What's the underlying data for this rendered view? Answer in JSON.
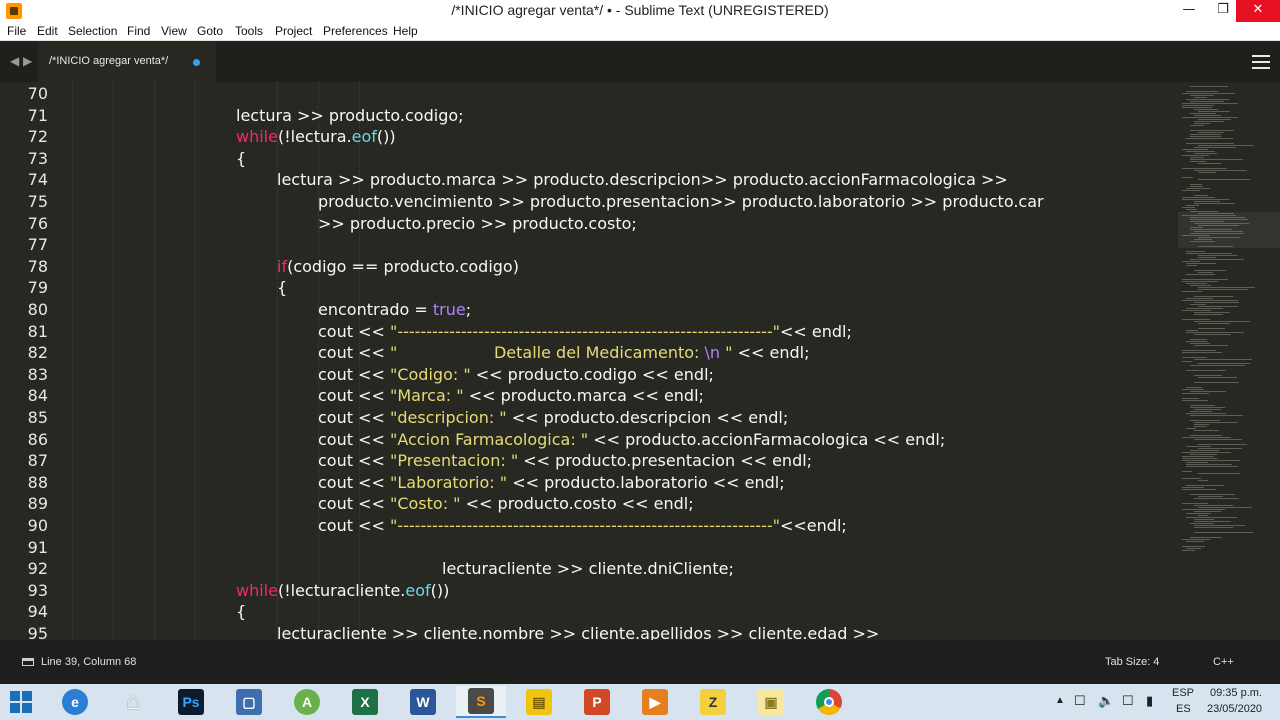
{
  "window": {
    "title": "/*INICIO agregar venta*/ • - Sublime Text (UNREGISTERED)"
  },
  "menu": [
    "File",
    "Edit",
    "Selection",
    "Find",
    "View",
    "Goto",
    "Tools",
    "Project",
    "Preferences",
    "Help"
  ],
  "tab": {
    "label": "/*INICIO agregar venta*/"
  },
  "editor": {
    "line_numbers": [
      "70",
      "71",
      "72",
      "73",
      "74",
      "75",
      "76",
      "77",
      "78",
      "79",
      "80",
      "81",
      "82",
      "83",
      "84",
      "85",
      "86",
      "87",
      "88",
      "89",
      "90",
      "91",
      "92",
      "93",
      "94",
      "95"
    ],
    "lines": [
      [],
      [
        {
          "t": "lectura >> producto.codigo;"
        }
      ],
      [
        {
          "t": "while",
          "c": "kw"
        },
        {
          "t": "(!lectura."
        },
        {
          "t": "eof",
          "c": "fn"
        },
        {
          "t": "())"
        }
      ],
      [
        {
          "t": "{"
        }
      ],
      [
        {
          "t": "lectura >> producto.marca >> producto.descripcion>> producto.accionFarmacologica >>"
        }
      ],
      [
        {
          "t": "producto.vencimiento >> producto.presentacion>> producto.laboratorio >> producto.car"
        }
      ],
      [
        {
          "t": ">> producto.precio >> producto.costo;"
        }
      ],
      [],
      [
        {
          "t": "if",
          "c": "kw"
        },
        {
          "t": "(codigo == producto.codigo)"
        }
      ],
      [
        {
          "t": "{"
        }
      ],
      [
        {
          "t": "encontrado = "
        },
        {
          "t": "true",
          "c": "bool"
        },
        {
          "t": ";"
        }
      ],
      [
        {
          "t": "cout << "
        },
        {
          "t": "\"-----------------------------------------------------------------\"",
          "c": "str"
        },
        {
          "t": "<< endl;"
        }
      ],
      [
        {
          "t": "cout << "
        },
        {
          "t": "\"                   Detalle del Medicamento: ",
          "c": "str"
        },
        {
          "t": "\\n",
          "c": "esc"
        },
        {
          "t": " \"",
          "c": "str"
        },
        {
          "t": " << endl;"
        }
      ],
      [
        {
          "t": "cout << "
        },
        {
          "t": "\"Codigo: \"",
          "c": "str"
        },
        {
          "t": " << producto.codigo << endl;"
        }
      ],
      [
        {
          "t": "cout << "
        },
        {
          "t": "\"Marca: \"",
          "c": "str"
        },
        {
          "t": " << producto.marca << endl;"
        }
      ],
      [
        {
          "t": "cout << "
        },
        {
          "t": "\"descripcion: \"",
          "c": "str"
        },
        {
          "t": " << producto.descripcion << endl;"
        }
      ],
      [
        {
          "t": "cout << "
        },
        {
          "t": "\"Accion Farmacologica: \"",
          "c": "str"
        },
        {
          "t": " << producto.accionFarmacologica << endl;"
        }
      ],
      [
        {
          "t": "cout << "
        },
        {
          "t": "\"Presentacion: \"",
          "c": "str"
        },
        {
          "t": " << producto.presentacion << endl;"
        }
      ],
      [
        {
          "t": "cout << "
        },
        {
          "t": "\"Laboratorio: \"",
          "c": "str"
        },
        {
          "t": " << producto.laboratorio << endl;"
        }
      ],
      [
        {
          "t": "cout << "
        },
        {
          "t": "\"Costo: \"",
          "c": "str"
        },
        {
          "t": " << producto.costo << endl;"
        }
      ],
      [
        {
          "t": "cout << "
        },
        {
          "t": "\"-----------------------------------------------------------------\"",
          "c": "str"
        },
        {
          "t": "<<endl;"
        }
      ],
      [],
      [
        {
          "t": "lecturacliente >> cliente.dniCliente;"
        }
      ],
      [
        {
          "t": "while",
          "c": "kw"
        },
        {
          "t": "(!lecturacliente."
        },
        {
          "t": "eof",
          "c": "fn"
        },
        {
          "t": "())"
        }
      ],
      [
        {
          "t": "{"
        }
      ],
      [
        {
          "t": "lecturacliente >> cliente.nombre >> cliente.apellidos >> cliente.edad >>"
        }
      ]
    ]
  },
  "status": {
    "position": "Line 39, Column 68",
    "tab_size": "Tab Size: 4",
    "syntax": "C++"
  },
  "taskbar": {
    "apps": [
      "ie-icon",
      "home-icon",
      "photoshop-icon",
      "virtualbox-icon",
      "android-studio-icon",
      "excel-icon",
      "word-icon",
      "sublime-text-icon",
      "file-explorer-icon",
      "powerpoint-icon",
      "media-player-icon",
      "zinf-icon",
      "sticky-notes-icon",
      "chrome-icon"
    ],
    "lang_top": "ESP",
    "lang_bottom": "ES",
    "time": "09:35 p.m.",
    "date": "23/05/2020"
  }
}
